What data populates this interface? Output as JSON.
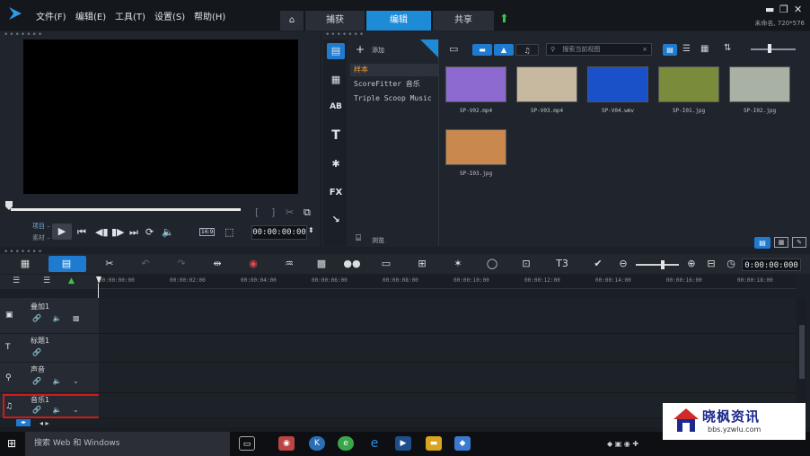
{
  "menu": [
    "文件(F)",
    "编辑(E)",
    "工具(T)",
    "设置(S)",
    "帮助(H)"
  ],
  "tabs": {
    "home_icon": "home-icon",
    "capture": "捕获",
    "edit": "编辑",
    "share": "共享"
  },
  "project_info": "未命名, 720*576",
  "preview": {
    "project_label": "项目 –",
    "clip_label": "素材 –",
    "aspect": "16:9",
    "timecode": "00:00:00:00"
  },
  "library": {
    "add_label": "添加",
    "folders": [
      "样本",
      "ScoreFitter 音乐",
      "Triple Scoop Music"
    ],
    "browse_label": "浏览",
    "search_placeholder": "搜索当前视图",
    "thumbnails": [
      {
        "name": "SP-V02.mp4",
        "color": "#8c6ad0"
      },
      {
        "name": "SP-V03.mp4",
        "color": "#c7b9a0"
      },
      {
        "name": "SP-V04.wmv",
        "color": "#1a50c8"
      },
      {
        "name": "SP-I01.jpg",
        "color": "#7a8b3c"
      },
      {
        "name": "SP-I02.jpg",
        "color": "#a9b0a4"
      },
      {
        "name": "SP-I03.jpg",
        "color": "#c9894e"
      }
    ]
  },
  "timeline": {
    "timecode": "0:00:00:000",
    "ruler": [
      "00:00:00:00",
      "00:00:02:00",
      "00:00:04:00",
      "00:00:06:00",
      "00:00:08:00",
      "00:00:10:00",
      "00:00:12:00",
      "00:00:14:00",
      "00:00:16:00",
      "00:00:18:00"
    ],
    "tracks": [
      "叠加1",
      "标题1",
      "声音",
      "音乐1"
    ]
  },
  "taskbar": {
    "search": "搜索 Web 和 Windows"
  },
  "watermark": {
    "title": "晓枫资讯",
    "url": "bbs.yzwlu.com"
  }
}
